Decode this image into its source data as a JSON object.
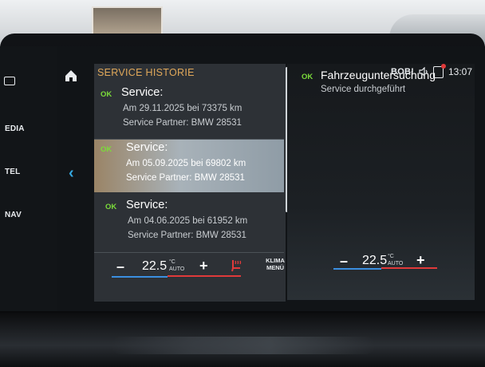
{
  "rail": {
    "items": [
      "EDIA",
      "TEL",
      "NAV"
    ]
  },
  "status": {
    "profile": "BOB!",
    "time": "13:07"
  },
  "list": {
    "title": "SERVICE HISTORIE",
    "entries": [
      {
        "ok": "OK",
        "heading": "Service:",
        "date_line": "Am 29.11.2025 bei 73375 km",
        "partner": "Service Partner: BMW 28531"
      },
      {
        "ok": "OK",
        "heading": "Service:",
        "date_line": "Am 05.09.2025 bei 69802 km",
        "partner": "Service Partner: BMW 28531"
      },
      {
        "ok": "OK",
        "heading": "Service:",
        "date_line": "Am 04.06.2025 bei 61952 km",
        "partner": "Service Partner: BMW 28531"
      }
    ]
  },
  "detail": {
    "ok": "OK",
    "title": "Fahrzeuguntersuchung",
    "status": "Service durchgeführt"
  },
  "climate": {
    "minus": "–",
    "plus": "+",
    "left_temp": "22.5",
    "right_temp": "22.5",
    "unit": "°C",
    "mode": "AUTO",
    "menu_line1": "KLIMA",
    "menu_line2": "MENÜ"
  },
  "colors": {
    "accent_title": "#e0a85a",
    "ok_green": "#7bdc3a",
    "back_blue": "#35a8e0"
  },
  "icons": {
    "home": "home-icon",
    "back": "chevron-left-icon",
    "sound": "speaker-icon",
    "notification": "notification-icon",
    "seat_heat": "seat-heating-icon"
  }
}
